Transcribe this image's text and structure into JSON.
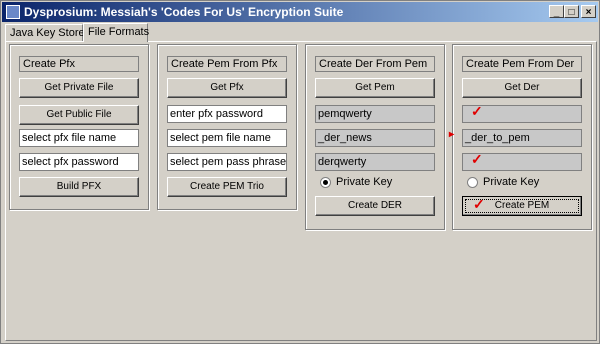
{
  "window": {
    "title": "Dysprosium: Messiah's 'Codes For Us' Encryption Suite"
  },
  "controls": {
    "minimize": "_",
    "maximize": "□",
    "close": "×"
  },
  "tabs": [
    "Java Key Store",
    "File Formats"
  ],
  "active_tab": "File Formats",
  "panels": {
    "pfx": {
      "header": "Create Pfx",
      "private_button": "Get Private File",
      "public_button": "Get Public File",
      "name_field": "select pfx file name",
      "password_field": "select pfx password",
      "build_button": "Build PFX"
    },
    "pem_from_pfx": {
      "header": "Create Pem From Pfx",
      "get_button": "Get Pfx",
      "password_field": "enter pfx password",
      "pem_name_field": "select pem file name",
      "pass_phrase_field": "select pem pass phrase",
      "create_button": "Create PEM Trio"
    },
    "der_from_pem": {
      "header": "Create Der From Pem",
      "get_button": "Get Pem",
      "pem_field": "pemqwerty",
      "der_name_field": "_der_news",
      "der_pass_field": "derqwerty",
      "radio_label": "Private Key",
      "radio_selected": true,
      "create_button": "Create DER"
    },
    "pem_from_der": {
      "header": "Create Pem From Der",
      "get_button": "Get Der",
      "field1": "",
      "field2": "_der_to_pem",
      "field3": "",
      "radio_label": "Private Key",
      "radio_selected": false,
      "create_button": "Create PEM"
    }
  },
  "annotations": {
    "check_mark": "✓",
    "arrow_mark": "▸",
    "color": "#e00000"
  }
}
